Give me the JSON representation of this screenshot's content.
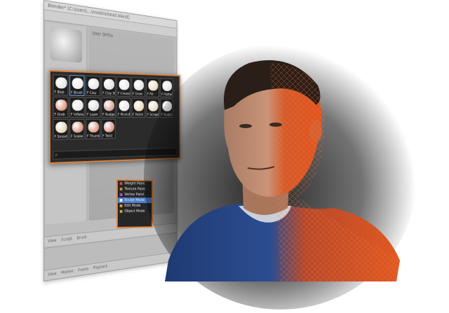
{
  "window": {
    "title": "Blender* [C:\\Users\\...\\models\\head.blend]"
  },
  "viewport": {
    "label": "User Ortho"
  },
  "palette": {
    "tiles": [
      {
        "label": "F Blob",
        "color": "#d9d9d9",
        "selected": false
      },
      {
        "label": "F Brush",
        "color": "#e6e6e6",
        "selected": true
      },
      {
        "label": "F Clay",
        "color": "#dcdcdc",
        "selected": false
      },
      {
        "label": "F Clay Strips",
        "color": "#d4d4d4",
        "selected": false
      },
      {
        "label": "F Crease",
        "color": "#e0e0e0",
        "selected": false
      },
      {
        "label": "F Draw",
        "color": "#d8d8d8",
        "selected": false
      },
      {
        "label": "F Fill",
        "color": "#e3c9a4",
        "selected": false
      },
      {
        "label": "F Flatten",
        "color": "#d6d6d6",
        "selected": false
      },
      {
        "label": "F Grab",
        "color": "#d06a48",
        "selected": false
      },
      {
        "label": "F Inflate/Deflate",
        "color": "#dfdfdf",
        "selected": false
      },
      {
        "label": "F Layer",
        "color": "#d2d2d2",
        "selected": false
      },
      {
        "label": "F Nudge",
        "color": "#c47a63",
        "selected": false
      },
      {
        "label": "F Pinch/Magnify",
        "color": "#dedede",
        "selected": false
      },
      {
        "label": "F Polish",
        "color": "#e0c9a0",
        "selected": false
      },
      {
        "label": "F Scrape/Peaks",
        "color": "#dcc6a2",
        "selected": false
      },
      {
        "label": "F Sculpt",
        "color": "#d4d4d4",
        "selected": false
      },
      {
        "label": "F Smooth",
        "color": "#ddc59e",
        "selected": false
      },
      {
        "label": "F Snake Hook",
        "color": "#c96b4c",
        "selected": false
      },
      {
        "label": "F Thumb",
        "color": "#c8704f",
        "selected": false
      },
      {
        "label": "F Twist",
        "color": "#c56b55",
        "selected": false
      }
    ]
  },
  "mode_menu": {
    "items": [
      {
        "label": "Weight Paint",
        "color": "#c94f4f",
        "active": false
      },
      {
        "label": "Texture Paint",
        "color": "#d08a3a",
        "active": false
      },
      {
        "label": "Vertex Paint",
        "color": "#b04fc9",
        "active": false
      },
      {
        "label": "Sculpt Mode",
        "color": "#ffffff",
        "active": true
      },
      {
        "label": "Edit Mode",
        "color": "#e0a030",
        "active": false
      },
      {
        "label": "Object Mode",
        "color": "#e0a030",
        "active": false
      }
    ]
  },
  "bottom_bar": {
    "items": [
      "View",
      "Sculpt",
      "Brush"
    ]
  },
  "footer_bar": {
    "items": [
      "View",
      "Marker",
      "Frame",
      "Playback"
    ]
  }
}
